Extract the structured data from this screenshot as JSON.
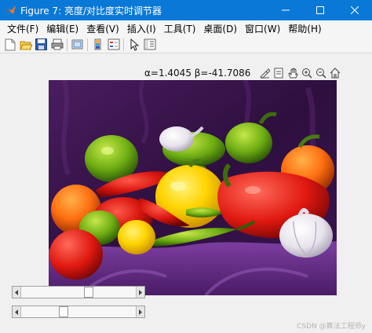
{
  "window": {
    "title": "Figure 7: 亮度/对比度实时调节器"
  },
  "menu": [
    "文件(F)",
    "编辑(E)",
    "查看(V)",
    "插入(I)",
    "工具(T)",
    "桌面(D)",
    "窗口(W)",
    "帮助(H)"
  ],
  "toolbar": {
    "icons": [
      "new-figure-icon",
      "open-icon",
      "save-icon",
      "print-icon",
      "link-plot-icon",
      "colorbar-icon",
      "legend-icon",
      "edit-plot-icon",
      "property-inspector-icon"
    ]
  },
  "readout": "α=1.4045  β=-41.7086",
  "axes_toolbar": {
    "icons": [
      "brush-icon",
      "datatip-icon",
      "pan-icon",
      "zoom-in-icon",
      "zoom-out-icon",
      "home-icon"
    ]
  },
  "sliders": [
    {
      "name": "alpha-slider",
      "value_fraction": 0.6
    },
    {
      "name": "beta-slider",
      "value_fraction": 0.36
    }
  ],
  "watermark": "CSDN @算法工程师y",
  "colors": {
    "titlebar": "#0a78d7",
    "background": "#f0f0f0",
    "backdrop_cloth": "#3c1650",
    "drape": "#6a2f88"
  }
}
